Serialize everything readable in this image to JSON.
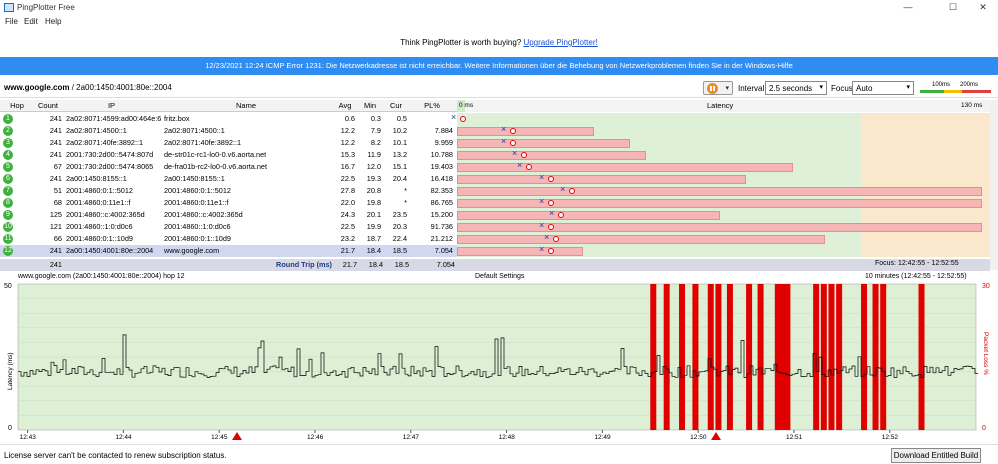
{
  "window": {
    "title": "PingPlotter Free",
    "minimize": "—",
    "maximize": "☐",
    "close": "✕"
  },
  "menu": [
    "File",
    "Edit",
    "Help"
  ],
  "promo": {
    "text": "Think PingPlotter is worth buying? ",
    "link": "Upgrade PingPlotter!"
  },
  "alert": "12/23/2021 12:24 ICMP Error 1231: Die Netzwerkadresse ist nicht erreichbar. Weitere Informationen über die Behebung von Netzwerkproblemen finden Sie in der Windows-Hilfe",
  "toolbar": {
    "target_host": "www.google.com",
    "target_rest": " / 2a00:1450:4001:80e::2004",
    "interval_label": "Interval",
    "interval_value": "2.5 seconds",
    "focus_label": "Focus",
    "focus_value": "Auto",
    "legend_100": "100ms",
    "legend_200": "200ms"
  },
  "table": {
    "headers": [
      "Hop",
      "Count",
      "IP",
      "Name",
      "Avg",
      "Min",
      "Cur",
      "PL%",
      "0 ms",
      "Latency",
      "130 ms"
    ],
    "rows": [
      {
        "hop": "1",
        "count": "241",
        "ip": "2a02:8071:4599:ad00:464e:6",
        "name": "fritz.box",
        "avg": "0.6",
        "min": "0.3",
        "cur": "0.5",
        "pl": "",
        "bar": 0.0,
        "markx": 0.005
      },
      {
        "hop": "2",
        "count": "241",
        "ip": "2a02:8071:4500::1",
        "name": "2a02:8071:4500::1",
        "avg": "12.2",
        "min": "7.9",
        "cur": "10.2",
        "pl": "7.884",
        "bar": 0.26,
        "markx": 0.1
      },
      {
        "hop": "3",
        "count": "241",
        "ip": "2a02:8071:40fe:3892::1",
        "name": "2a02:8071:40fe:3892::1",
        "avg": "12.2",
        "min": "8.2",
        "cur": "10.1",
        "pl": "9.959",
        "bar": 0.33,
        "markx": 0.1
      },
      {
        "hop": "4",
        "count": "241",
        "ip": "2001:730:2d00::5474:807d",
        "name": "de-str01c-rc1-lo0-0.v6.aorta.net",
        "avg": "15.3",
        "min": "11.9",
        "cur": "13.2",
        "pl": "10.788",
        "bar": 0.36,
        "markx": 0.12
      },
      {
        "hop": "5",
        "count": "67",
        "ip": "2001:730:2d00::5474:8065",
        "name": "de-fra01b-rc2-lo0-0.v6.aorta.net",
        "avg": "16.7",
        "min": "12.0",
        "cur": "15.1",
        "pl": "19.403",
        "bar": 0.64,
        "markx": 0.13
      },
      {
        "hop": "6",
        "count": "241",
        "ip": "2a00:1450:8155::1",
        "name": "2a00:1450:8155::1",
        "avg": "22.5",
        "min": "19.3",
        "cur": "20.4",
        "pl": "16.418",
        "bar": 0.55,
        "markx": 0.17
      },
      {
        "hop": "7",
        "count": "51",
        "ip": "2001:4860:0:1::5012",
        "name": "2001:4860:0:1::5012",
        "avg": "27.8",
        "min": "20.8",
        "cur": "*",
        "pl": "82.353",
        "bar": 1.0,
        "markx": 0.21
      },
      {
        "hop": "8",
        "count": "68",
        "ip": "2001:4860:0:11e1::f",
        "name": "2001:4860:0:11e1::f",
        "avg": "22.0",
        "min": "19.8",
        "cur": "*",
        "pl": "86.765",
        "bar": 1.0,
        "markx": 0.17
      },
      {
        "hop": "9",
        "count": "125",
        "ip": "2001:4860::c:4002:365d",
        "name": "2001:4860::c:4002:365d",
        "avg": "24.3",
        "min": "20.1",
        "cur": "23.5",
        "pl": "15.200",
        "bar": 0.5,
        "markx": 0.19
      },
      {
        "hop": "10",
        "count": "121",
        "ip": "2001:4860::1:0:d0c6",
        "name": "2001:4860::1:0:d0c6",
        "avg": "22.5",
        "min": "19.9",
        "cur": "20.3",
        "pl": "91.736",
        "bar": 1.0,
        "markx": 0.17
      },
      {
        "hop": "11",
        "count": "66",
        "ip": "2001:4860:0:1::10d9",
        "name": "2001:4860:0:1::10d9",
        "avg": "23.2",
        "min": "18.7",
        "cur": "22.4",
        "pl": "21.212",
        "bar": 0.7,
        "markx": 0.18
      },
      {
        "hop": "12",
        "count": "241",
        "ip": "2a00:1450:4001:80e::2004",
        "name": "www.google.com",
        "avg": "21.7",
        "min": "18.4",
        "cur": "18.5",
        "pl": "7.054",
        "bar": 0.24,
        "markx": 0.17
      }
    ],
    "round_trip": {
      "count": "241",
      "label": "Round Trip (ms)",
      "avg": "21.7",
      "min": "18.4",
      "cur": "18.5",
      "pl": "7.054",
      "focus": "Focus: 12:42:55 - 12:52:55"
    }
  },
  "graph": {
    "target_label": "www.google.com (2a00:1450:4001:80e::2004) hop 12",
    "settings_label": "Default Settings",
    "range_label": "10 minutes (12:42:55 - 12:52:55)",
    "ylabel_left": "Latency (ms)",
    "ylabel_right": "Packet Loss %",
    "y_left_ticks": [
      "50",
      "0"
    ],
    "y_right_ticks": [
      "30",
      "0"
    ],
    "x_ticks": [
      "12:43",
      "12:44",
      "12:45",
      "12:46",
      "12:47",
      "12:48",
      "12:49",
      "12:50",
      "12:51",
      "12:52"
    ],
    "loss_events_min": [
      12.72,
      12.74,
      49.5,
      49.64,
      49.8,
      49.94,
      50.1,
      50.18,
      50.3,
      50.5,
      50.62,
      50.8,
      50.85,
      50.9,
      51.2,
      51.28,
      51.36,
      51.44,
      51.7,
      51.82,
      51.9,
      52.3
    ]
  },
  "status": {
    "text": "License server can't be contacted to renew subscription status.",
    "button": "Download Entitled Build"
  },
  "colors": {
    "alert_bg": "#2f8cf0",
    "good": "#3eb13e",
    "loss": "#e00000",
    "bar": "#f7b6b6"
  }
}
